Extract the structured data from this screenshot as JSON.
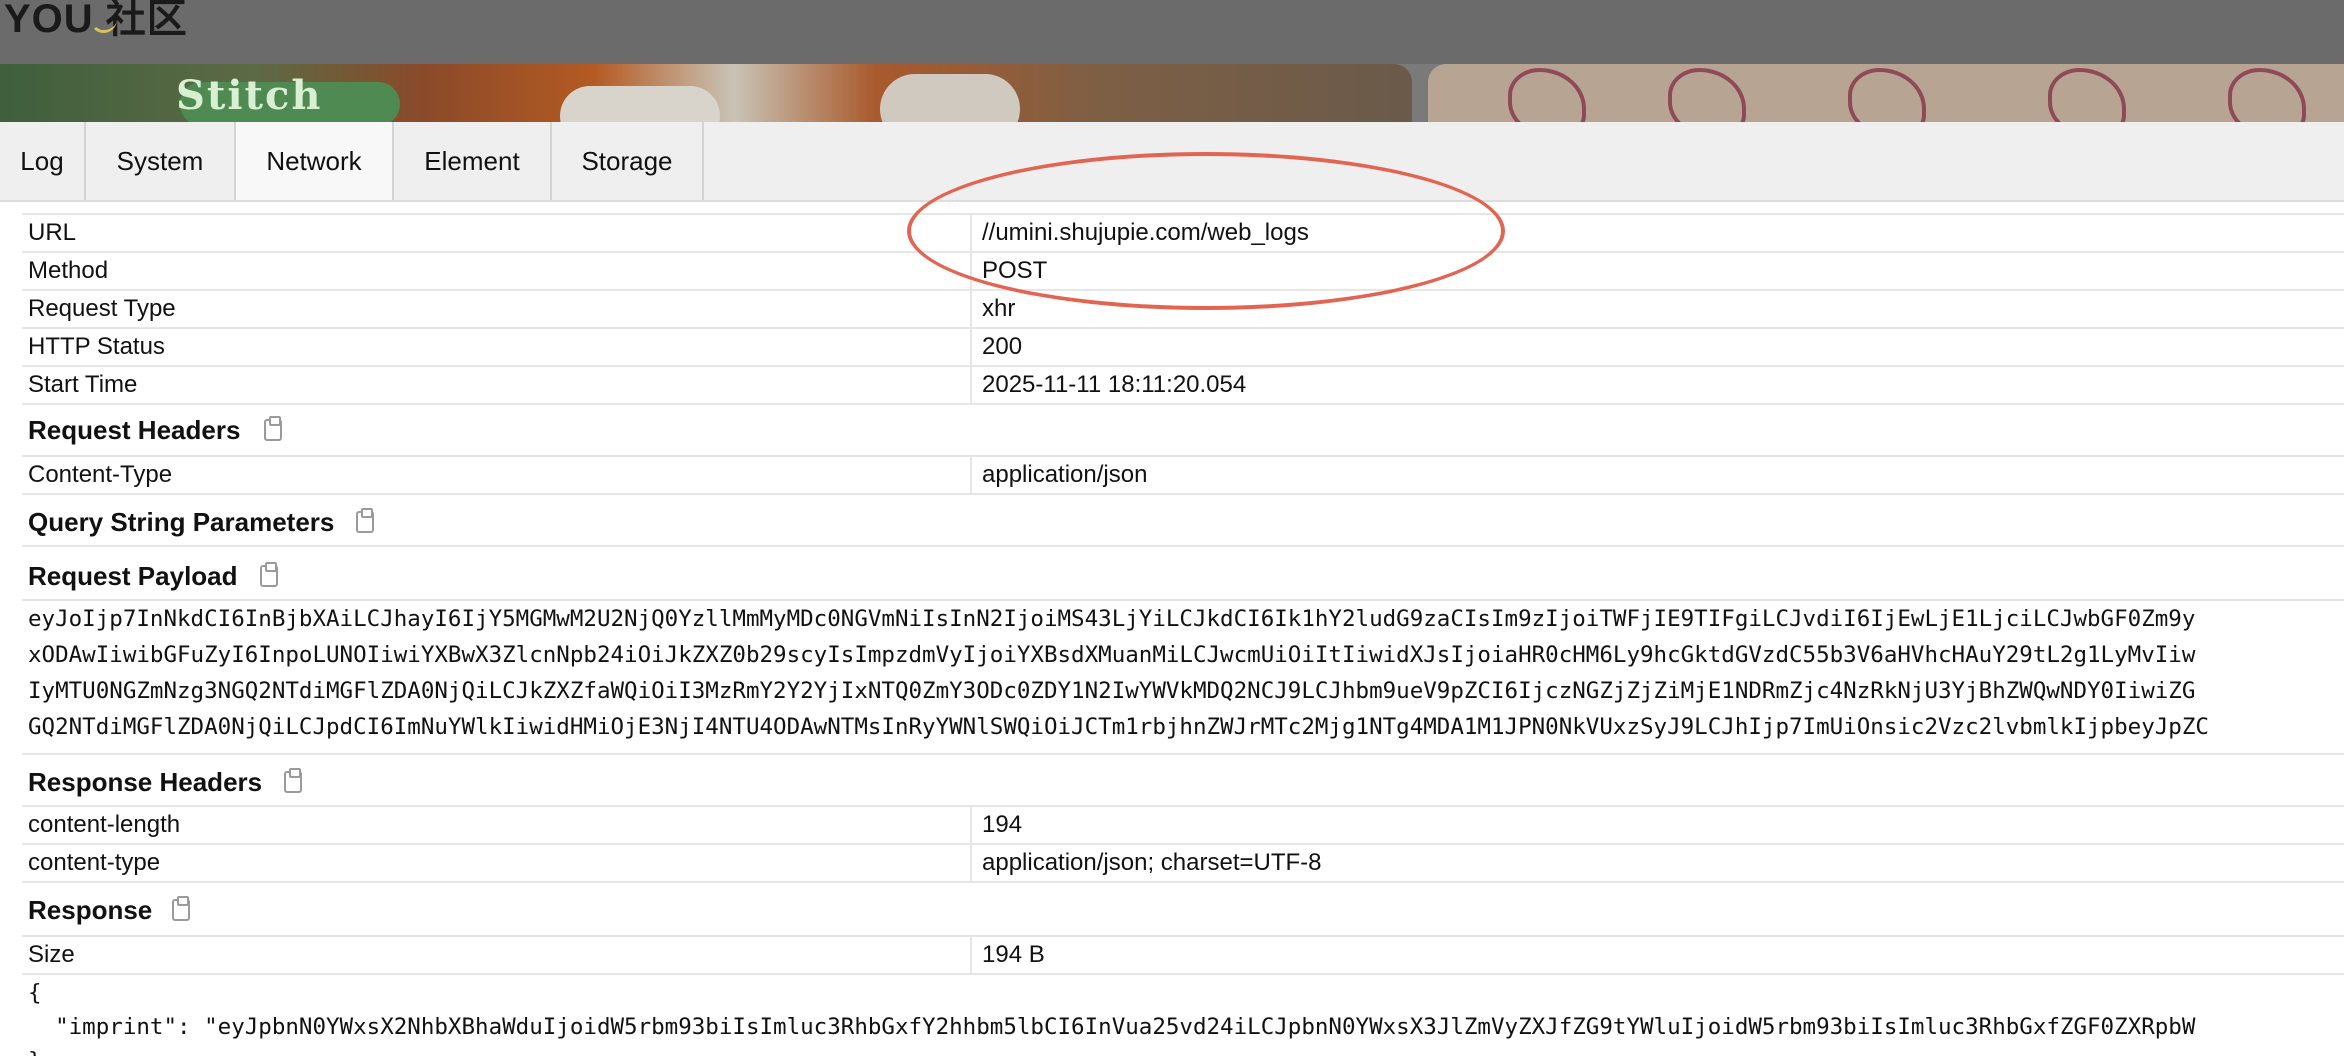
{
  "app": {
    "title": "YOU 社区"
  },
  "banner": {
    "left_text": "Stitch"
  },
  "tabs": [
    {
      "label": "Log"
    },
    {
      "label": "System"
    },
    {
      "label": "Network"
    },
    {
      "label": "Element"
    },
    {
      "label": "Storage"
    }
  ],
  "general": [
    {
      "key": "URL",
      "value": "//umini.shujupie.com/web_logs"
    },
    {
      "key": "Method",
      "value": "POST"
    },
    {
      "key": "Request Type",
      "value": "xhr"
    },
    {
      "key": "HTTP Status",
      "value": "200"
    },
    {
      "key": "Start Time",
      "value": "2025-11-11 18:11:20.054"
    }
  ],
  "sections": {
    "request_headers": "Request Headers",
    "query_params": "Query String Parameters",
    "request_payload": "Request Payload",
    "response_headers": "Response Headers",
    "response": "Response"
  },
  "request_headers": [
    {
      "key": "Content-Type",
      "value": "application/json"
    }
  ],
  "payload_lines": [
    "eyJoIjp7InNkdCI6InBjbXAiLCJhayI6IjY5MGMwM2U2NjQ0YzllMmMyMDc0NGVmNiIsInN2IjoiMS43LjYiLCJkdCI6Ik1hY2ludG9zaCIsIm9zIjoiTWFjIE9TIFgiLCJvdiI6IjEwLjE1LjciLCJwbGF0Zm9y",
    "xODAwIiwibGFuZyI6InpoLUNOIiwiYXBwX3ZlcnNpb24iOiJkZXZ0b29scyIsImpzdmVyIjoiYXBsdXMuanMiLCJwcmUiOiItIiwidXJsIjoiaHR0cHM6Ly9hcGktdGVzdC55b3V6aHVhcHAuY29tL2g1LyMvIiw",
    "IyMTU0NGZmNzg3NGQ2NTdiMGFlZDA0NjQiLCJkZXZfaWQiOiI3MzRmY2Y2YjIxNTQ0ZmY3ODc0ZDY1N2IwYWVkMDQ2NCJ9LCJhbm9ueV9pZCI6IjczNGZjZjZiMjE1NDRmZjc4NzRkNjU3YjBhZWQwNDY0IiwiZG",
    "GQ2NTdiMGFlZDA0NjQiLCJpdCI6ImNuYWlkIiwidHMiOjE3NjI4NTU4ODAwNTMsInRyYWNlSWQiOiJCTm1rbjhnZWJrMTc2Mjg1NTg4MDA1M1JPN0NkVUxzSyJ9LCJhIjp7ImUiOnsic2Vzc2lvbmlkIjpbeyJpZC"
  ],
  "response_headers": [
    {
      "key": "content-length",
      "value": "194"
    },
    {
      "key": "content-type",
      "value": "application/json; charset=UTF-8"
    }
  ],
  "response_meta": [
    {
      "key": "Size",
      "value": "194 B"
    }
  ],
  "response_body_lines": [
    "{",
    "  \"imprint\": \"eyJpbnN0YWxsX2NhbXBhaWduIjoidW5rbm93biIsImluc3RhbGxfY2hhbm5lbCI6InVua25vd24iLCJpbnN0YWxsX3JlZmVyZXJfZG9tYWluIjoidW5rbm93biIsImluc3RhbGxfZGF0ZXRpbW",
    "}"
  ],
  "colors": {
    "annotation": "#e26553",
    "tab_bg": "#efefef",
    "border": "#e6e6e6"
  }
}
